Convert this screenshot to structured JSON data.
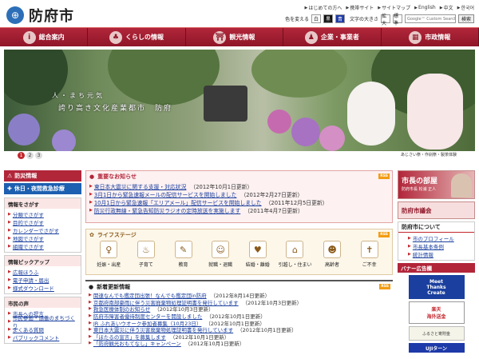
{
  "header": {
    "logo_text": "防府市",
    "links": [
      {
        "label": "はじめての方へ"
      },
      {
        "label": "携帯サイト"
      },
      {
        "label": "サイトマップ"
      },
      {
        "label": "English"
      },
      {
        "label": "中文"
      },
      {
        "label": "한국어"
      }
    ],
    "color_label": "色を変える",
    "color_buttons": [
      "白",
      "黒",
      "青"
    ],
    "textsize_label": "文字の大きさ",
    "textsize_buttons": [
      "拡大",
      "標準"
    ],
    "search_placeholder": "Google™ Custom Search",
    "search_button": "検索"
  },
  "nav": {
    "items": [
      {
        "label": "総合案内",
        "icon": "info-icon"
      },
      {
        "label": "くらしの情報",
        "icon": "life-icon"
      },
      {
        "label": "観光情報",
        "icon": "shrine-icon"
      },
      {
        "label": "企業・事業者",
        "icon": "business-icon"
      },
      {
        "label": "市政情報",
        "icon": "cityhall-icon"
      }
    ]
  },
  "hero": {
    "copy1": "人・まち元気",
    "copy2": "誇り高き文化産業都市　防府",
    "dots": [
      "1",
      "2",
      "3"
    ],
    "caption": "あじさい祭・作刹祭・製茶体験"
  },
  "left": {
    "disaster": "防災情報",
    "holiday": "休日・夜間救急診療",
    "sections": [
      {
        "title": "情報をさがす",
        "items": [
          "分類でさがす",
          "目的でさがす",
          "カレンダーでさがす",
          "地図でさがす",
          "組織でさがす"
        ]
      },
      {
        "title": "情報ピックアップ",
        "items": [
          "広報ほうふ",
          "電子申請・届出",
          "様式ダウンロード"
        ]
      },
      {
        "title": "市民の声",
        "items": [
          "市長への提言",
          "市民参画・協働のまちづくり",
          "よくある質問",
          "パブリックコメント"
        ]
      }
    ]
  },
  "important": {
    "title": "重要なお知らせ",
    "rss": "RSS",
    "items": [
      {
        "text": "東日本大震災に関する支援・対応状況",
        "date": "（2012年10月1日更新）"
      },
      {
        "text": "3月1日から緊急速報メールの配信サービスを開始しました",
        "date": "（2012年2月27日更新）"
      },
      {
        "text": "10月1日から緊急速報「エリアメール」配信サービスを開始しました",
        "date": "（2011年12月5日更新）"
      },
      {
        "text": "防災行政無線・緊急告知防災ラジオの定時放送を実施します",
        "date": "（2011年4月7日更新）"
      }
    ]
  },
  "life": {
    "title": "ライフステージ",
    "rss": "RSS",
    "items": [
      {
        "label": "妊娠・出産",
        "icon": "pregnancy-icon"
      },
      {
        "label": "子育て",
        "icon": "baby-bottle-icon"
      },
      {
        "label": "教育",
        "icon": "school-icon"
      },
      {
        "label": "就職・退職",
        "icon": "work-icon"
      },
      {
        "label": "結婚・離婚",
        "icon": "couple-icon"
      },
      {
        "label": "引越し・住まい",
        "icon": "house-icon"
      },
      {
        "label": "高齢者",
        "icon": "elderly-icon"
      },
      {
        "label": "ご不幸",
        "icon": "condolence-icon"
      }
    ]
  },
  "news": {
    "title": "新着更新情報",
    "rss": "RSS",
    "items": [
      {
        "text": "関連なんでも鑑定団出張！なんでも鑑定団in防府",
        "date": "（2012年8月14日更新）"
      },
      {
        "text": "京都府南部豪雨に伴う災害廃棄物処理証明書を発行しています",
        "date": "（2012年10月3日更新）"
      },
      {
        "text": "救急医療体制のお知らせ",
        "date": "（2012年10月3日更新）"
      },
      {
        "text": "防府市障害者優待制度センターを開設しました",
        "date": "（2012年10月1日更新）"
      },
      {
        "text": "JR ふれあいウオーク参加者募集（10月23日）",
        "date": "（2012年10月1日更新）"
      },
      {
        "text": "東日本大震災に伴う災害廃棄物処理証明書を発行しています",
        "date": "（2012年10月1日更新）"
      },
      {
        "text": "「ほたるの宣言」を募集します",
        "date": "（2012年10月1日更新）"
      },
      {
        "text": "「防府観光おもてなし」キャンペーン",
        "date": "（2012年10月1日更新）"
      }
    ]
  },
  "right": {
    "mayor_title": "市長の部屋",
    "mayor_sub": "防府市長 松浦 正人",
    "council": "防府市議会",
    "about_title": "防府市について",
    "about_items": [
      "市のプロフィール",
      "市長基本条例",
      "統計情報"
    ],
    "banner_title": "バナー広告欄",
    "banners": {
      "mtc_line1": "Meet",
      "mtc_line2": "Thanks",
      "mtc_line3": "Create",
      "rakuten_line1": "楽天",
      "rakuten_line2": "海外送金",
      "furusato": "ふるさと寄附金",
      "uji": "UJIターン"
    }
  }
}
